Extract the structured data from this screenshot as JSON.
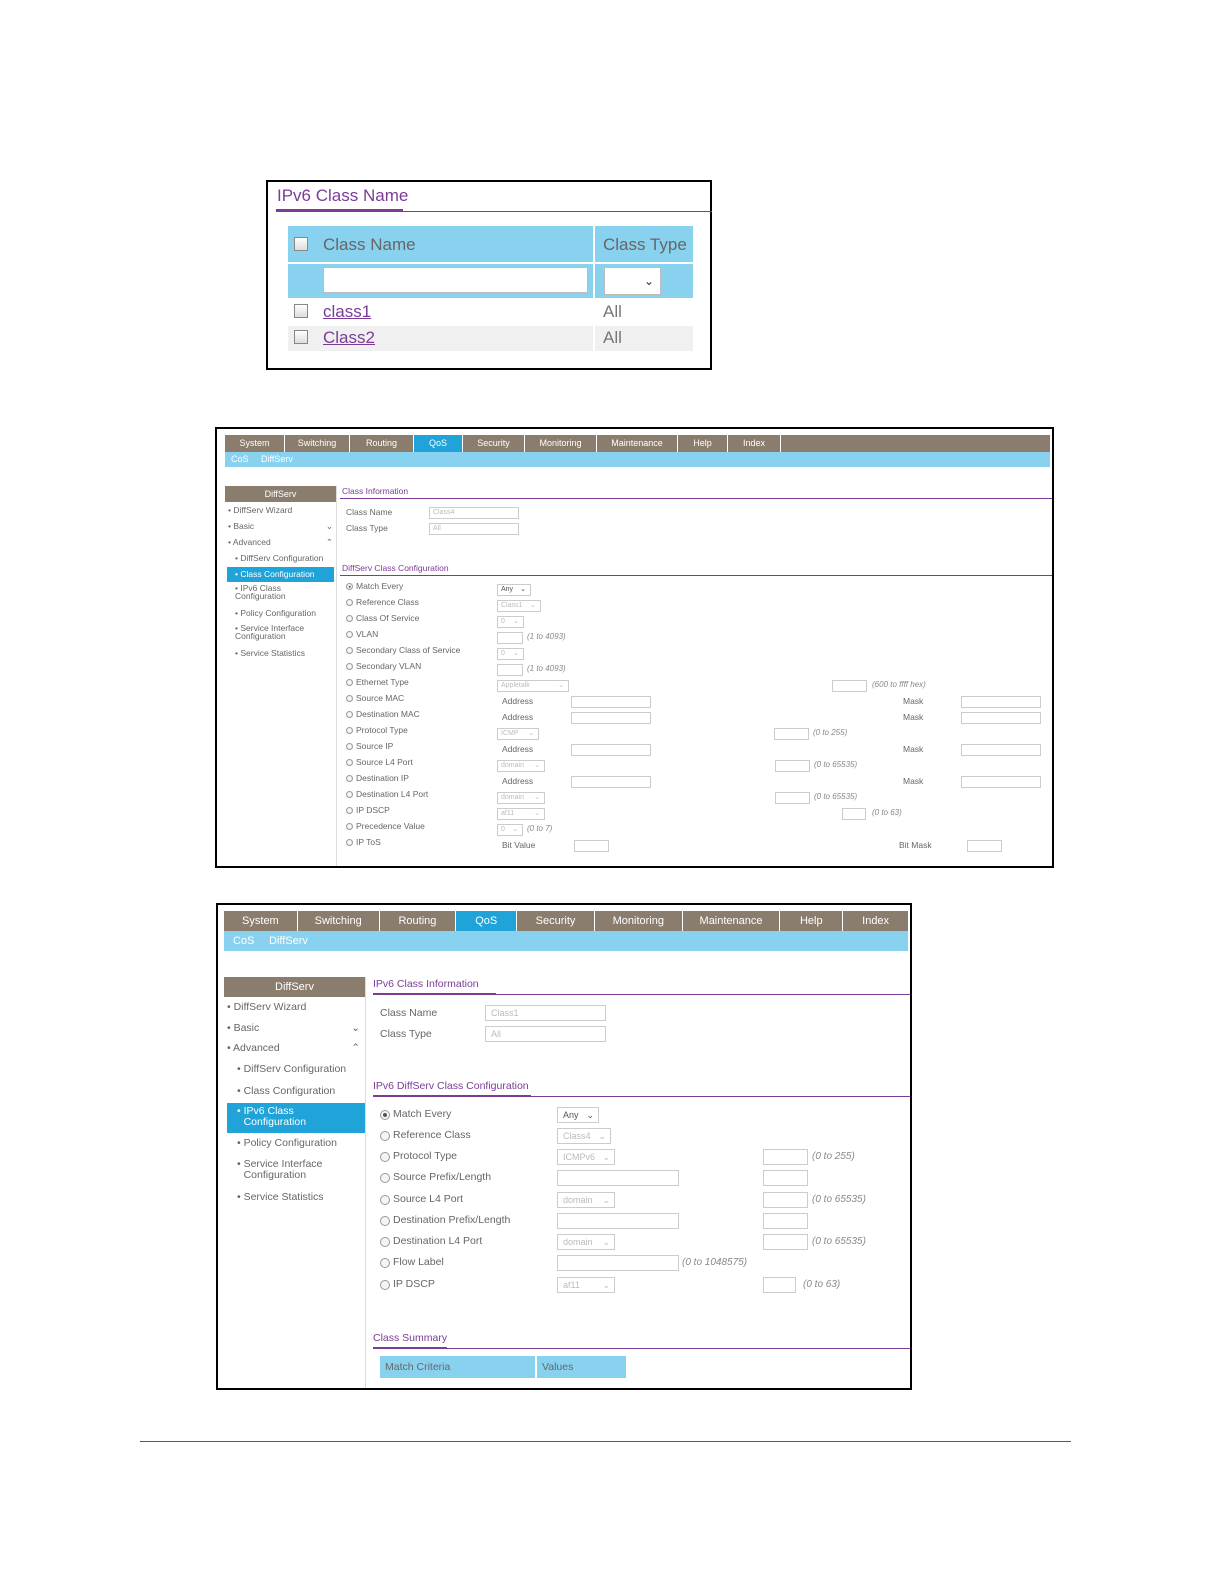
{
  "fig1": {
    "title": "IPv6 Class Name",
    "headers": {
      "class_name": "Class Name",
      "class_type": "Class Type"
    },
    "filter_select_chevron": "chevron-down-icon",
    "rows": [
      {
        "name": "class1",
        "type": "All"
      },
      {
        "name": "Class2",
        "type": "All"
      }
    ]
  },
  "fig2": {
    "nav": [
      "System",
      "Switching",
      "Routing",
      "QoS",
      "Security",
      "Monitoring",
      "Maintenance",
      "Help",
      "Index"
    ],
    "subnav": [
      "CoS",
      "DiffServ"
    ],
    "sidebar": {
      "title": "DiffServ",
      "items": [
        "DiffServ Wizard",
        "Basic",
        "Advanced",
        "DiffServ Configuration",
        "Class Configuration",
        "IPv6 Class Configuration",
        "Policy Configuration",
        "Service Interface Configuration",
        "Service Statistics"
      ]
    },
    "class_info": {
      "title": "Class Information",
      "class_name_label": "Class Name",
      "class_name_value": "Class4",
      "class_type_label": "Class Type",
      "class_type_value": "All"
    },
    "class_config": {
      "title": "DiffServ Class Configuration",
      "rows": [
        "Match Every",
        "Reference Class",
        "Class Of Service",
        "VLAN",
        "Secondary Class of Service",
        "Secondary VLAN",
        "Ethernet Type",
        "Source MAC",
        "Destination MAC",
        "Protocol Type",
        "Source IP",
        "Source L4 Port",
        "Destination IP",
        "Destination L4 Port",
        "IP DSCP",
        "Precedence Value",
        "IP ToS"
      ],
      "match_every_value": "Any",
      "reference_class_value": "Class1",
      "cos_value": "0",
      "vlan_hint": "(1 to 4093)",
      "secondary_cos_value": "0",
      "secondary_vlan_hint": "(1 to 4093)",
      "ethernet_type_value": "Appletalk",
      "ethernet_hint": "(600 to ffff hex)",
      "address_label": "Address",
      "mask_label": "Mask",
      "protocol_value": "ICMP",
      "protocol_hint": "(0 to 255)",
      "port_value": "domain",
      "port_hint": "(0 to 65535)",
      "dscp_value": "af11",
      "dscp_hint": "(0 to 63)",
      "precedence_value": "0",
      "precedence_hint": "(0 to 7)",
      "bit_value_label": "Bit Value",
      "bit_mask_label": "Bit Mask"
    }
  },
  "fig3": {
    "nav": [
      "System",
      "Switching",
      "Routing",
      "QoS",
      "Security",
      "Monitoring",
      "Maintenance",
      "Help",
      "Index"
    ],
    "subnav": [
      "CoS",
      "DiffServ"
    ],
    "sidebar": {
      "title": "DiffServ",
      "items": [
        "DiffServ Wizard",
        "Basic",
        "Advanced",
        "DiffServ Configuration",
        "Class Configuration",
        "IPv6 Class Configuration",
        "Policy Configuration",
        "Service Interface Configuration",
        "Service Statistics"
      ]
    },
    "class_info": {
      "title": "IPv6 Class Information",
      "class_name_label": "Class Name",
      "class_name_value": "Class1",
      "class_type_label": "Class Type",
      "class_type_value": "All"
    },
    "class_config": {
      "title": "IPv6 DiffServ Class Configuration",
      "rows": [
        "Match Every",
        "Reference Class",
        "Protocol Type",
        "Source Prefix/Length",
        "Source L4 Port",
        "Destination Prefix/Length",
        "Destination L4 Port",
        "Flow Label",
        "IP DSCP"
      ],
      "match_every_value": "Any",
      "reference_class_value": "Class4",
      "protocol_value": "ICMPv6",
      "protocol_hint": "(0 to 255)",
      "port_value": "domain",
      "port_hint": "(0 to 65535)",
      "flow_label_hint": "(0 to 1048575)",
      "dscp_value": "af11",
      "dscp_hint": "(0 to 63)"
    },
    "summary": {
      "title": "Class Summary",
      "col_match": "Match Criteria",
      "col_values": "Values"
    }
  }
}
